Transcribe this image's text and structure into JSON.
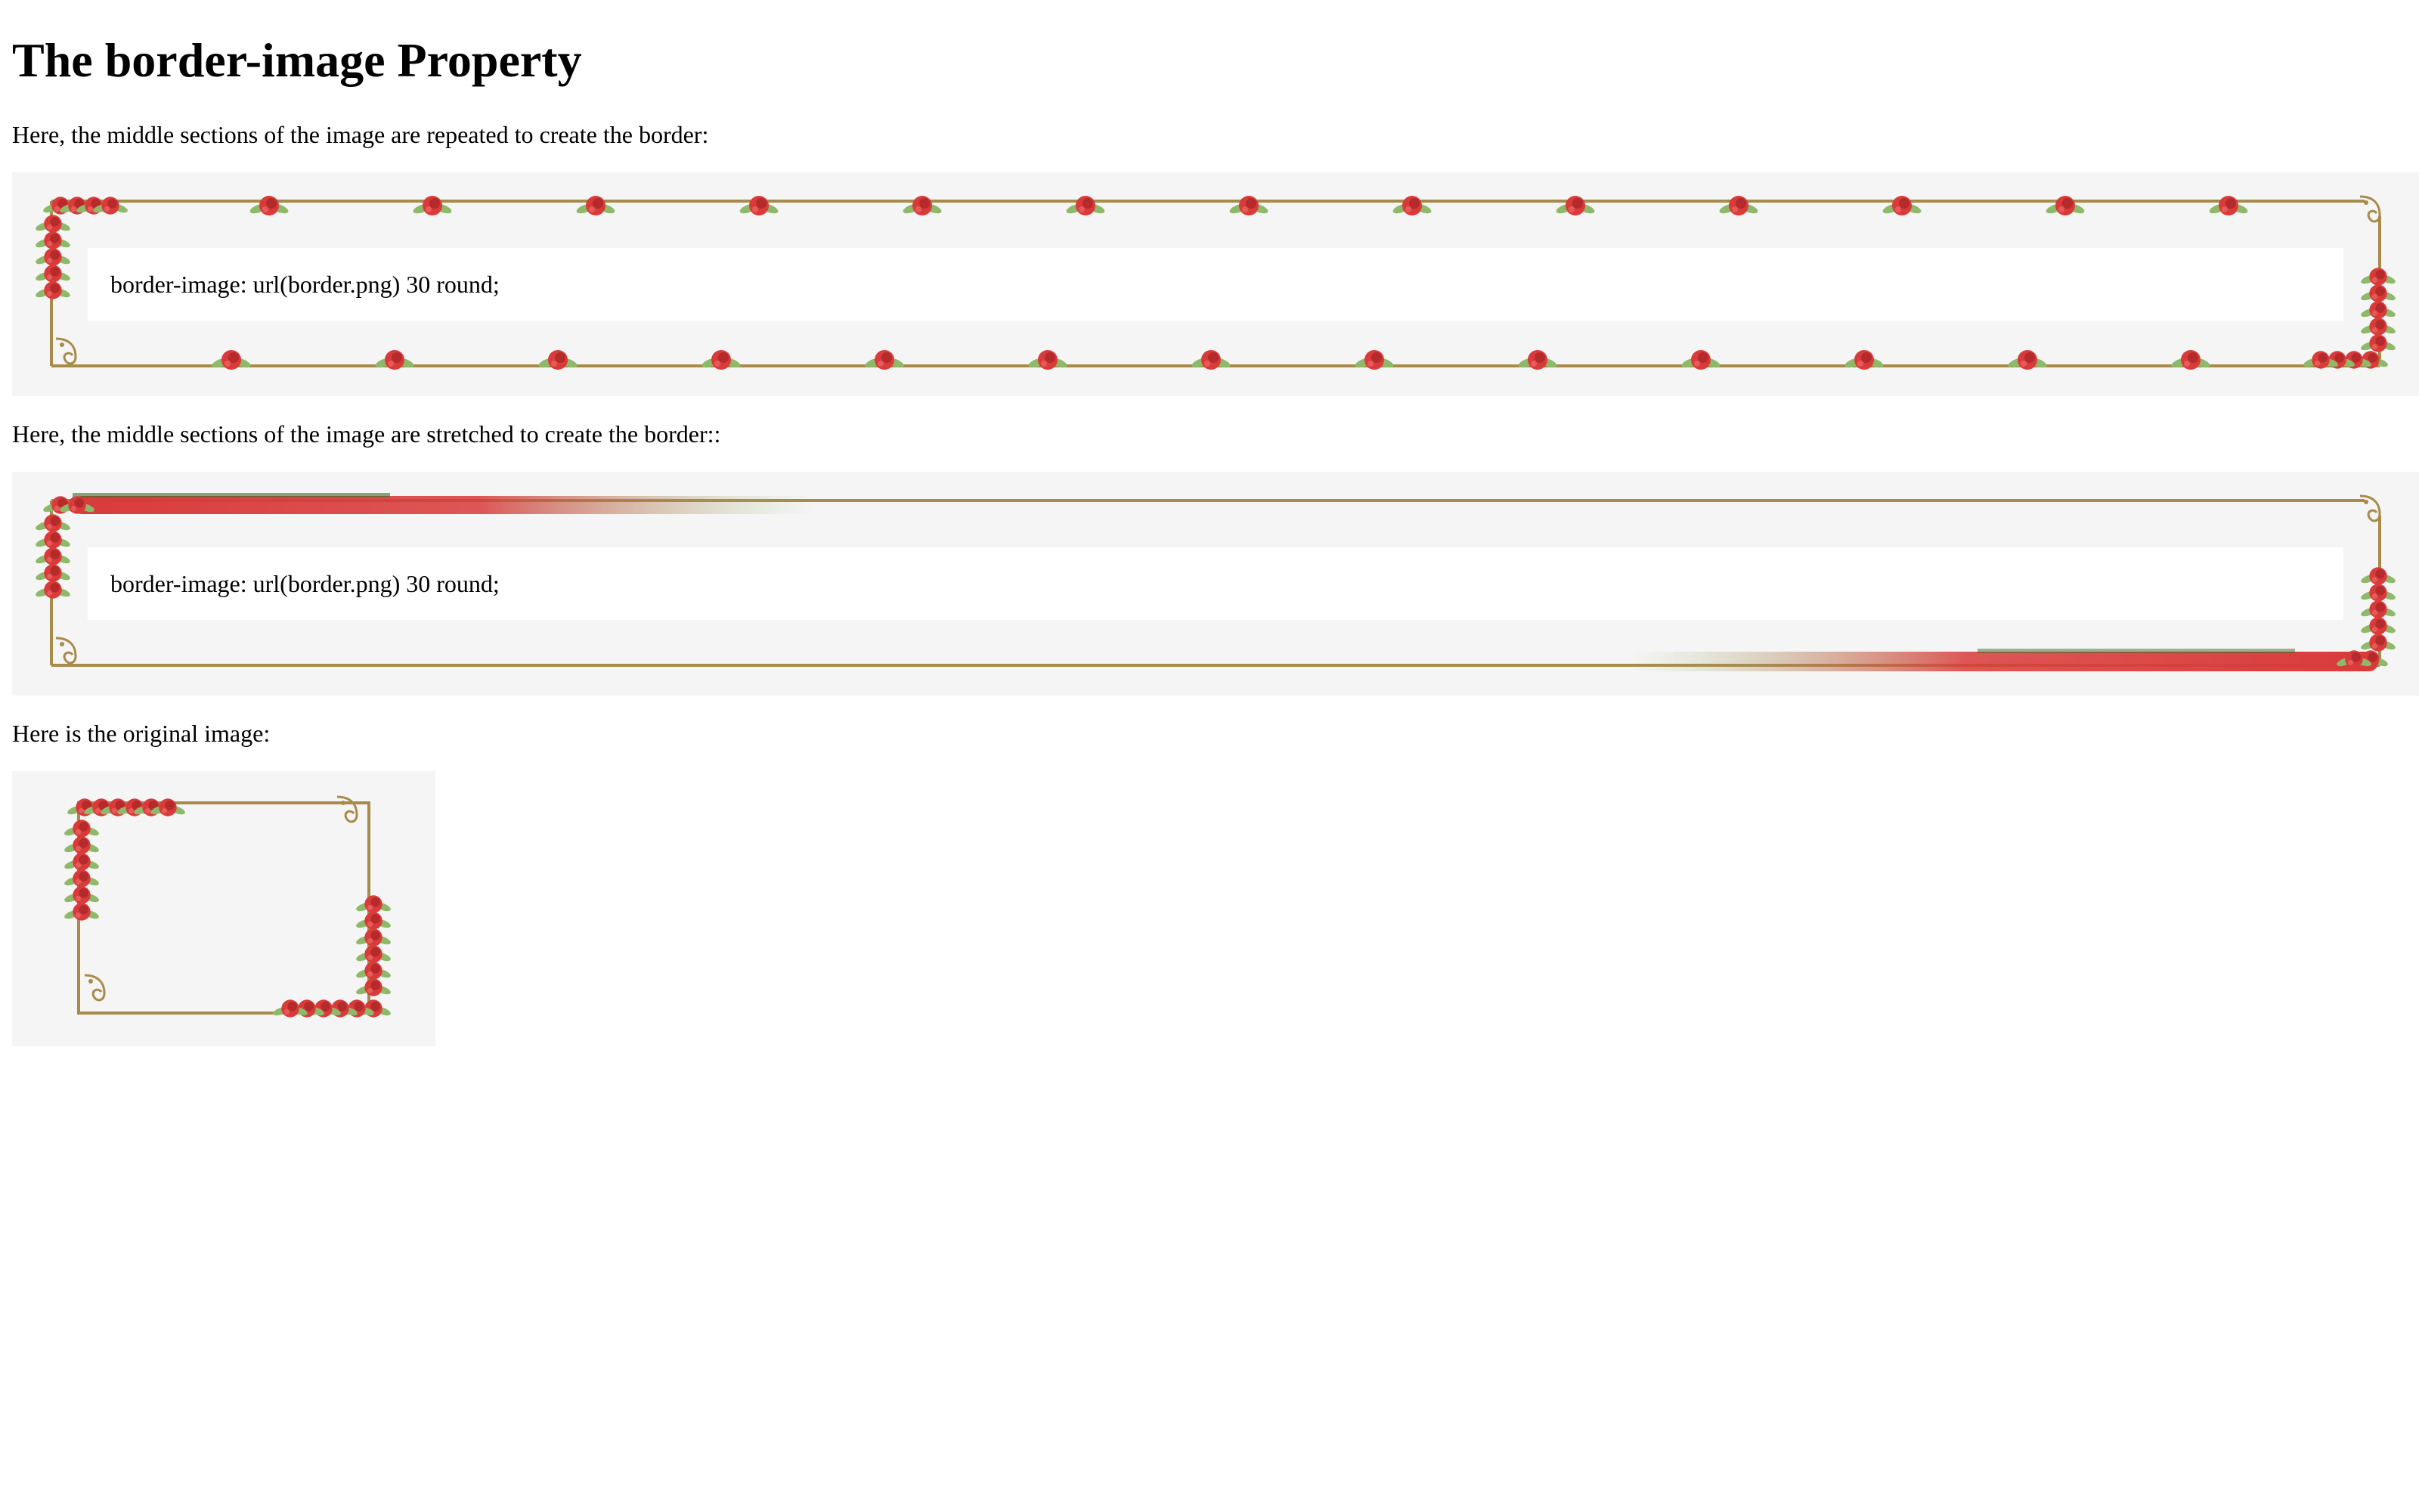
{
  "heading": "The border-image Property",
  "section1": {
    "text": "Here, the middle sections of the image are repeated to create the border:",
    "code": "border-image: url(border.png) 30 round;"
  },
  "section2": {
    "text": "Here, the middle sections of the image are stretched to create the border::",
    "code": "border-image: url(border.png) 30 round;"
  },
  "section3": {
    "text": "Here is the original image:"
  },
  "colors": {
    "panel_bg": "#f5f5f5",
    "frame_gold": "#a88a4a",
    "rose_red": "#d93a3a",
    "leaf_green": "#8fb96a"
  }
}
